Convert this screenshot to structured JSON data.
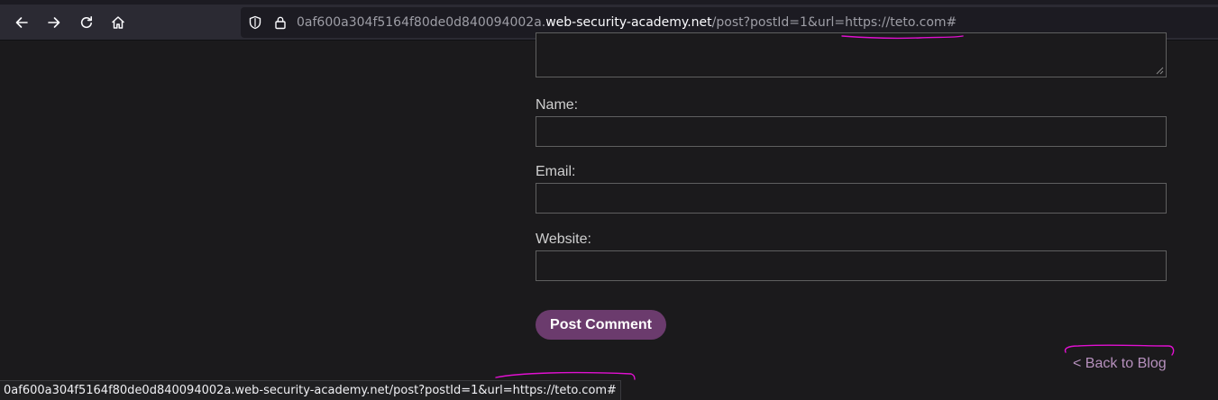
{
  "browser": {
    "url": {
      "subdomain": "0af600a304f5164f80de0d840094002a.",
      "domain": "web-security-academy.net",
      "path": "/post?postId=1&url=https://teto.com#"
    },
    "icons": {
      "back": "arrow-left-icon",
      "forward": "arrow-right-icon",
      "reload": "reload-icon",
      "home": "home-icon",
      "shield": "shield-icon",
      "lock": "lock-icon"
    },
    "status_url": "0af600a304f5164f80de0d840094002a.web-security-academy.net/post?postId=1&url=https://teto.com#"
  },
  "form": {
    "name_label": "Name:",
    "email_label": "Email:",
    "website_label": "Website:",
    "submit_label": "Post Comment"
  },
  "back_link": "< Back to Blog",
  "colors": {
    "page_bg": "#1b1a1c",
    "button_bg": "#6b3b6d",
    "link": "#b690bd",
    "annotation": "#e010d0"
  }
}
